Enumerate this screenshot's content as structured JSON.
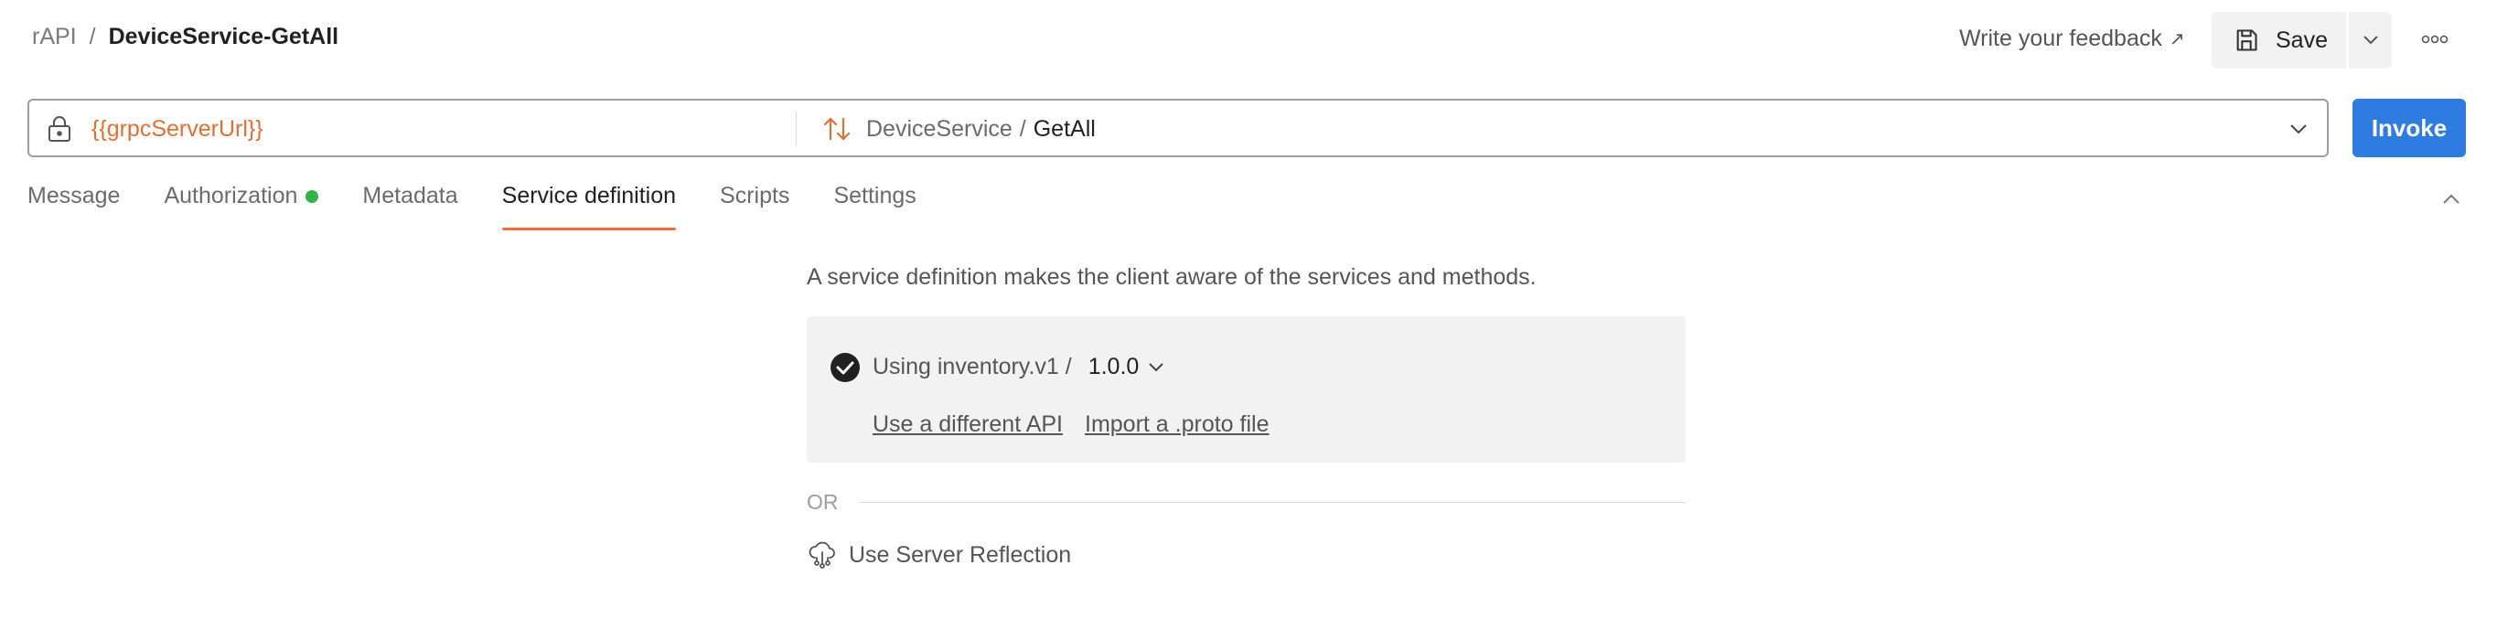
{
  "header": {
    "breadcrumb_parent": "rAPI",
    "breadcrumb_separator": "/",
    "breadcrumb_current": "DeviceService-GetAll",
    "feedback_label": "Write your feedback",
    "feedback_arrow": "↗",
    "save_label": "Save"
  },
  "urlbar": {
    "value": "{{grpcServerUrl}}",
    "service": "DeviceService",
    "separator": "/",
    "method": "GetAll"
  },
  "invoke_label": "Invoke",
  "tabs": [
    {
      "label": "Message"
    },
    {
      "label": "Authorization"
    },
    {
      "label": "Metadata"
    },
    {
      "label": "Service definition"
    },
    {
      "label": "Scripts"
    },
    {
      "label": "Settings"
    }
  ],
  "service_definition": {
    "description": "A service definition makes the client aware of the services and methods.",
    "using_label": "Using inventory.v1 /",
    "version": "1.0.0",
    "link_different_api": "Use a different API",
    "link_import_proto": "Import a .proto file",
    "or_label": "OR",
    "reflection_label": "Use Server Reflection"
  },
  "colors": {
    "accent_orange": "#f26b3a",
    "variable_orange": "#e07033",
    "invoke_blue": "#2e7ce0",
    "status_green": "#2fb344"
  },
  "icons": [
    "lock-icon",
    "method-arrows-icon",
    "chevron-down-icon",
    "save-icon",
    "more-icon",
    "chevron-up-icon",
    "check-circle-icon",
    "cloud-network-icon"
  ]
}
